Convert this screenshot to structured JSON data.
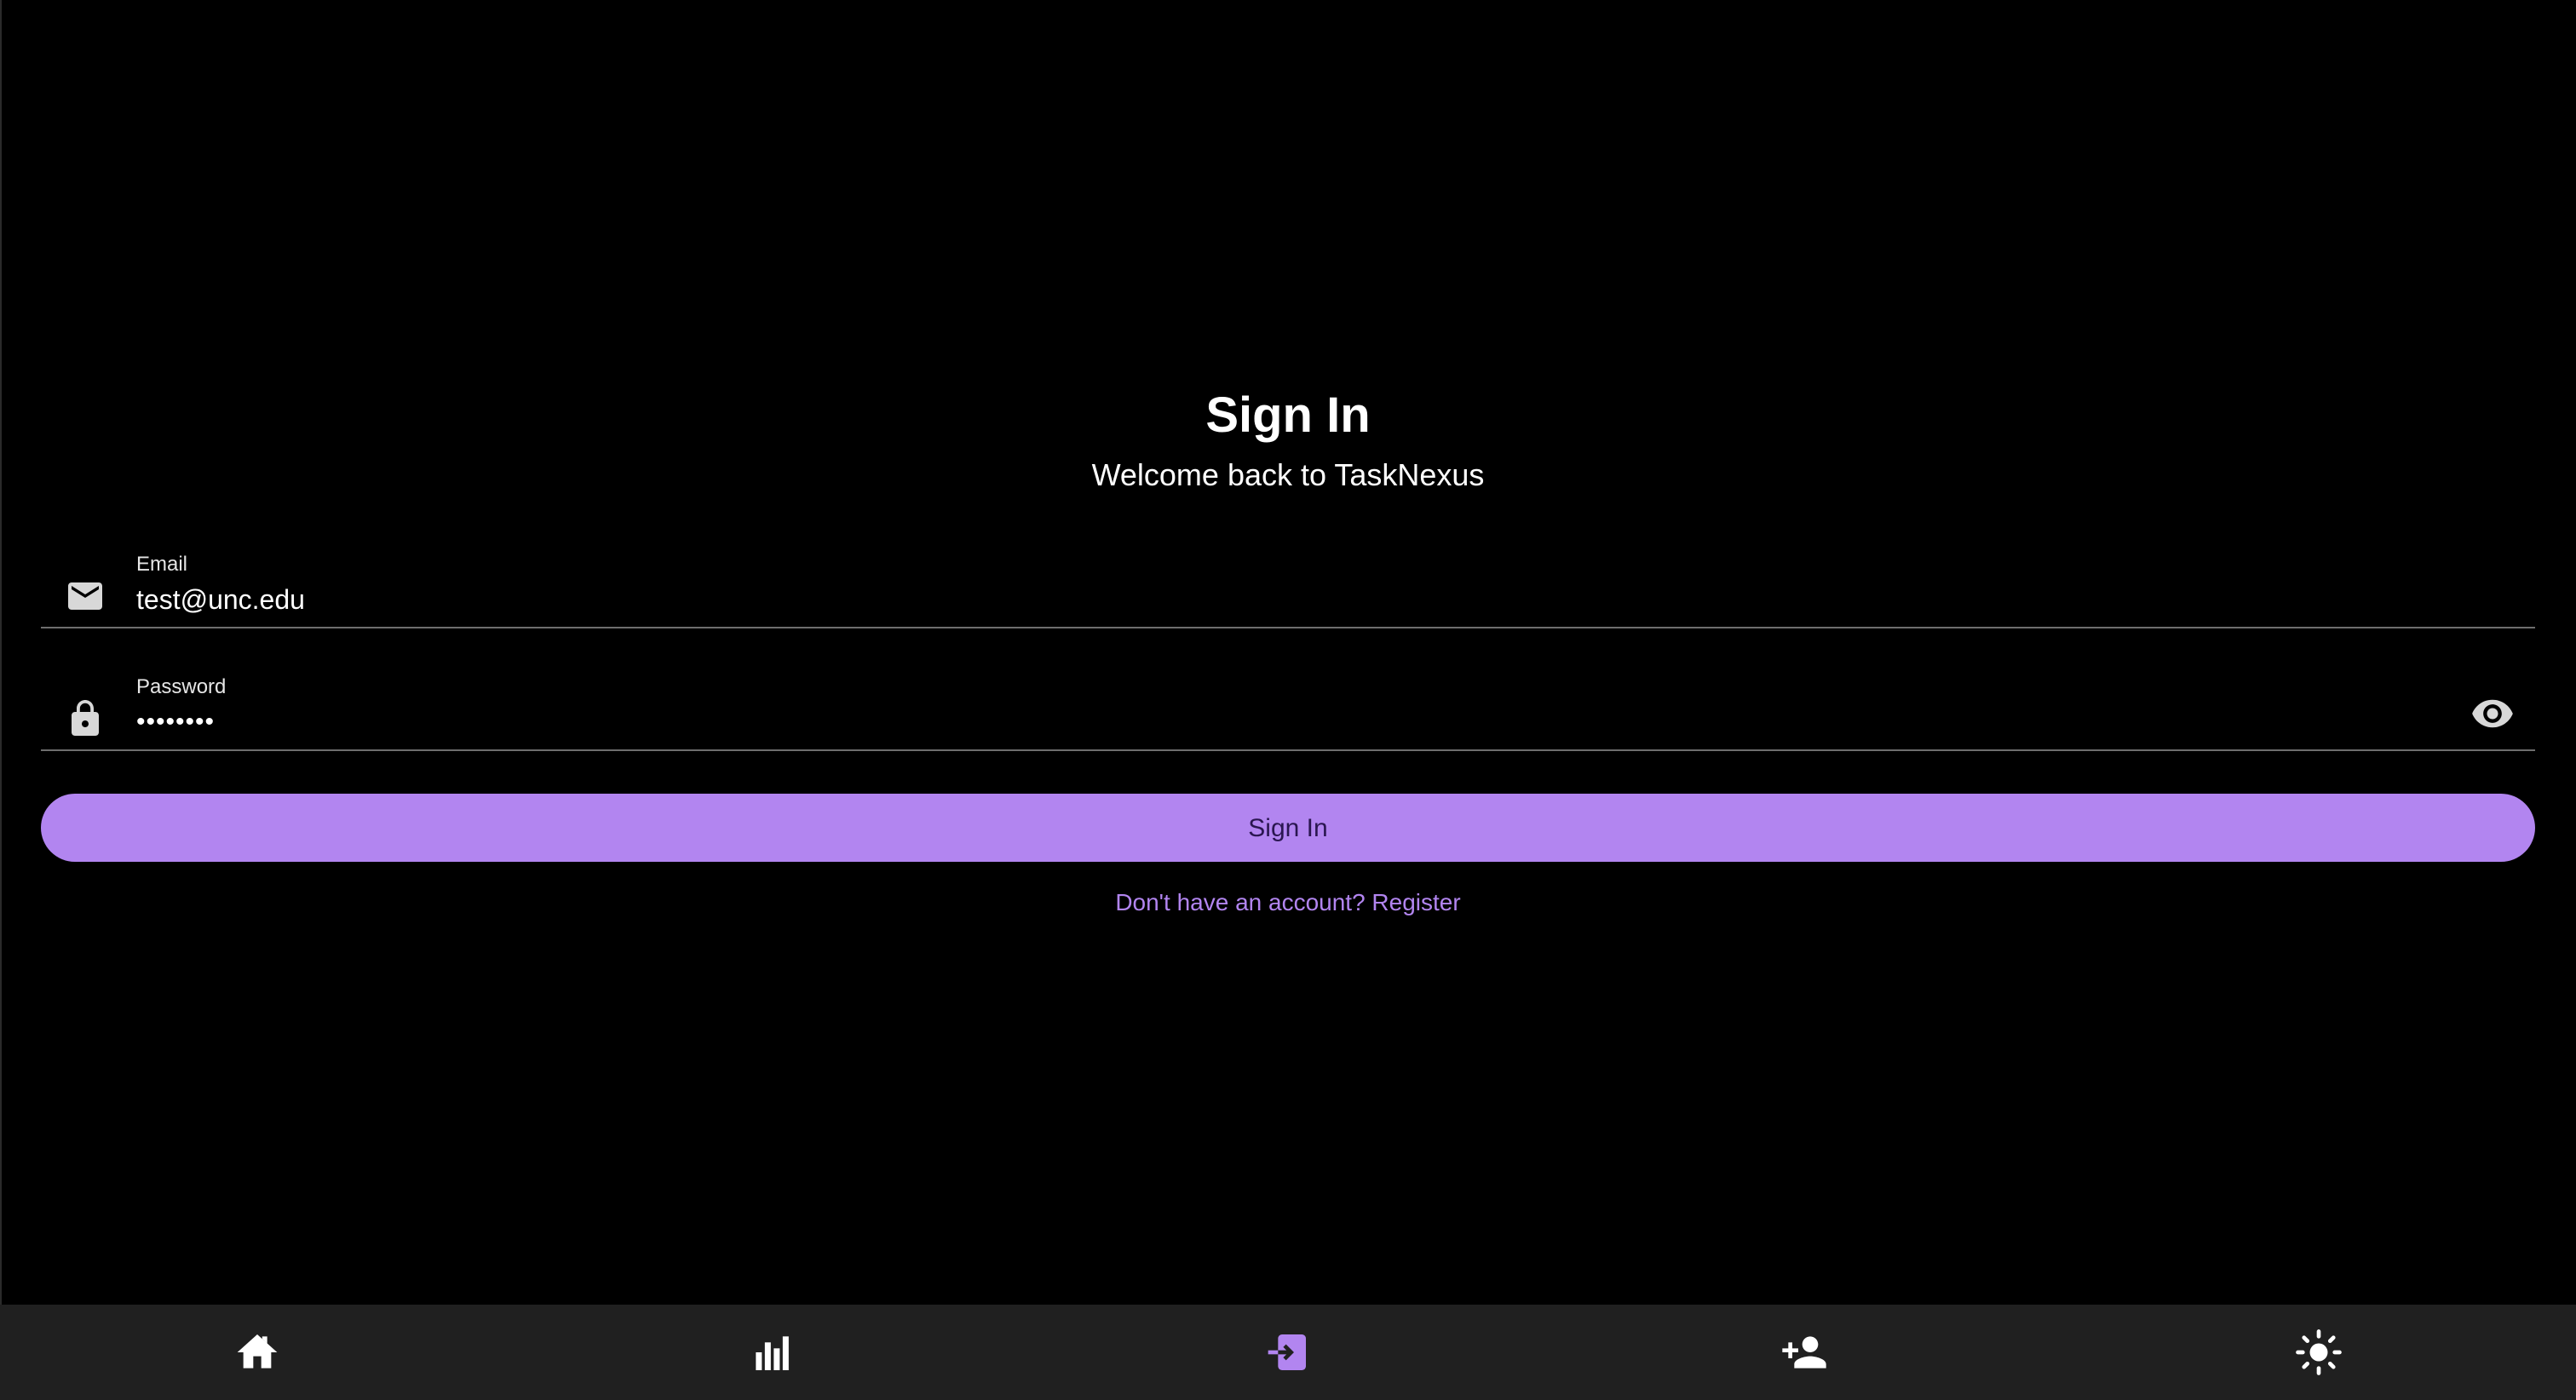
{
  "header": {
    "title": "Sign In",
    "subtitle": "Welcome back to TaskNexus"
  },
  "form": {
    "email": {
      "label": "Email",
      "value": "test@unc.edu",
      "icon": "mail-icon"
    },
    "password": {
      "label": "Password",
      "value": "••••••••",
      "icon": "lock-icon",
      "toggle_icon": "eye-icon"
    },
    "submit_label": "Sign In",
    "register_link": "Don't have an account? Register"
  },
  "bottom_nav": {
    "items": [
      {
        "icon": "home-icon",
        "active": false
      },
      {
        "icon": "bar-chart-icon",
        "active": false
      },
      {
        "icon": "login-icon",
        "active": true
      },
      {
        "icon": "add-person-icon",
        "active": false
      },
      {
        "icon": "sun-icon",
        "active": false
      }
    ]
  },
  "colors": {
    "background": "#000000",
    "accent": "#b285f0",
    "nav_background": "#202020",
    "button_text": "#2a1650"
  }
}
